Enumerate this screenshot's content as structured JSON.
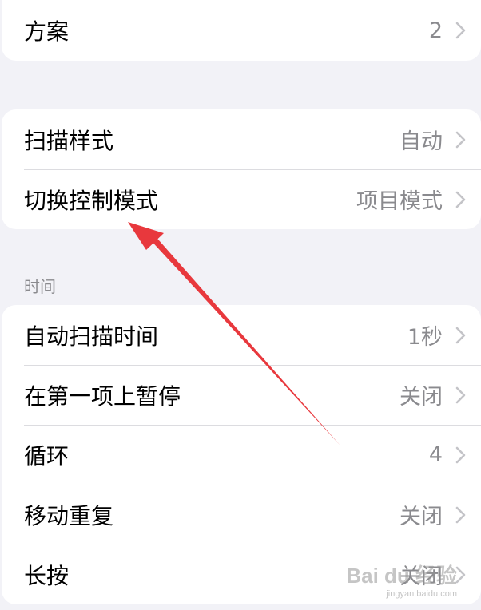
{
  "group1": {
    "rows": [
      {
        "label": "方案",
        "value": "2"
      }
    ]
  },
  "group2": {
    "rows": [
      {
        "label": "扫描样式",
        "value": "自动"
      },
      {
        "label": "切换控制模式",
        "value": "项目模式"
      }
    ]
  },
  "time_section": {
    "header": "时间",
    "rows": [
      {
        "label": "自动扫描时间",
        "value": "1秒"
      },
      {
        "label": "在第一项上暂停",
        "value": "关闭"
      },
      {
        "label": "循环",
        "value": "4"
      },
      {
        "label": "移动重复",
        "value": "关闭"
      },
      {
        "label": "长按",
        "value": "关闭"
      }
    ]
  },
  "watermark": {
    "main": "Bai du 经验",
    "sub": "jingyan.baidu.com"
  },
  "colors": {
    "background": "#f2f2f7",
    "card": "#ffffff",
    "secondary_text": "#8a8a8e",
    "annotation_arrow": "#e8383d"
  },
  "icons": {
    "row_chevron": "chevron-right-icon",
    "annotation": "red-arrow-icon"
  }
}
